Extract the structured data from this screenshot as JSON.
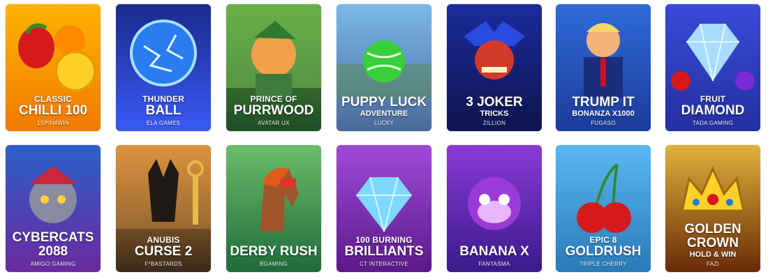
{
  "games": [
    {
      "id": "classic-chilli-100",
      "top": "CLASSIC",
      "title": "CHILLI 100",
      "bottom": "",
      "provider": "1SPIN4WIN",
      "bg": [
        "#ffb300",
        "#f07a00"
      ]
    },
    {
      "id": "thunder-ball",
      "top": "THUNDER",
      "title": "BALL",
      "bottom": "",
      "provider": "ELA GAMES",
      "bg": [
        "#1a2a8a",
        "#3a5af5"
      ]
    },
    {
      "id": "prince-of-purrwood",
      "top": "PRINCE OF",
      "title": "PURRWOOD",
      "bottom": "",
      "provider": "AVATAR UX",
      "bg": [
        "#5a9a3a",
        "#1f4d25"
      ]
    },
    {
      "id": "puppy-luck-adventure",
      "top": "",
      "title": "PUPPY LUCK",
      "bottom": "ADVENTURE",
      "provider": "LUCKY",
      "bg": [
        "#7ab8ea",
        "#4a6a9a"
      ]
    },
    {
      "id": "3-joker-tricks",
      "top": "",
      "title": "3 JOKER",
      "bottom": "TRICKS",
      "provider": "ZILLION",
      "bg": [
        "#1b2b9a",
        "#0e1450"
      ]
    },
    {
      "id": "trump-it-bonanza",
      "top": "",
      "title": "TRUMP IT",
      "bottom": "BONANZA X1000",
      "provider": "FUGASO",
      "bg": [
        "#2f6bd8",
        "#1b3b9a"
      ]
    },
    {
      "id": "fruit-diamond",
      "top": "FRUIT",
      "title": "DIAMOND",
      "bottom": "",
      "provider": "TADA GAMING",
      "bg": [
        "#3a4ad8",
        "#2330a0"
      ]
    },
    {
      "id": "cybercats-2088",
      "top": "",
      "title": "CYBERCATS 2088",
      "bottom": "",
      "provider": "AMIGO GAMING",
      "bg": [
        "#2b5fc8",
        "#6b2aa0"
      ]
    },
    {
      "id": "anubis-curse-2",
      "top": "ANUBIS",
      "title": "CURSE 2",
      "bottom": "",
      "provider": "F*BASTARDS",
      "bg": [
        "#d88a3a",
        "#3a2a1a"
      ]
    },
    {
      "id": "derby-rush",
      "top": "",
      "title": "DERBY RUSH",
      "bottom": "",
      "provider": "BGAMING",
      "bg": [
        "#6bbd6b",
        "#1f6b3a"
      ]
    },
    {
      "id": "100-burning-brilliants",
      "top": "100 BURNING",
      "title": "BRILLIANTS",
      "bottom": "",
      "provider": "CT INTERACTIVE",
      "bg": [
        "#a04ad8",
        "#5a1a8a"
      ]
    },
    {
      "id": "banana-x",
      "top": "",
      "title": "BANANA X",
      "bottom": "",
      "provider": "FANTASMA",
      "bg": [
        "#8a3ad8",
        "#3a1a8a"
      ]
    },
    {
      "id": "epic-8-goldrush",
      "top": "EPIC 8",
      "title": "GOLDRUSH",
      "bottom": "",
      "provider": "TRIPLE CHERRY",
      "bg": [
        "#5ab8f0",
        "#2a7ab8"
      ]
    },
    {
      "id": "golden-crown",
      "top": "",
      "title": "GOLDEN CROWN",
      "bottom": "HOLD & WIN",
      "provider": "FAZI",
      "bg": [
        "#e0b23a",
        "#6a2a0a"
      ]
    }
  ]
}
